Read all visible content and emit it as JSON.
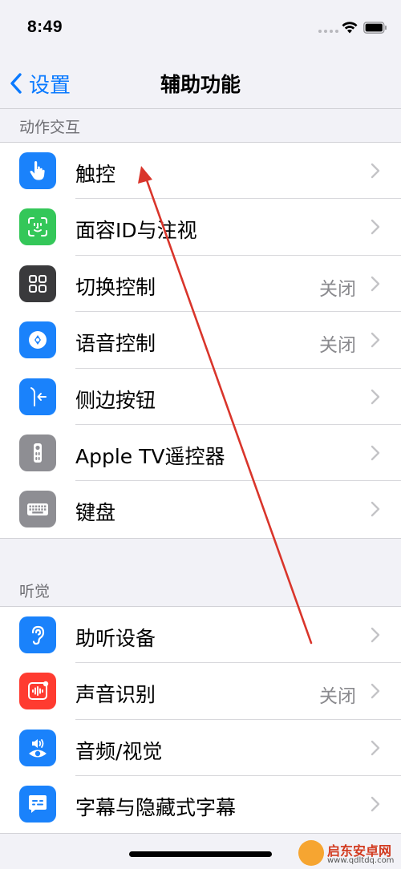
{
  "status_bar": {
    "time": "8:49"
  },
  "nav": {
    "back_label": "设置",
    "title": "辅助功能"
  },
  "sections": [
    {
      "header": "动作交互",
      "rows": [
        {
          "name": "touch",
          "label": "触控",
          "value": "",
          "icon": "hand-pointer-icon",
          "color": "#1a82fb"
        },
        {
          "name": "face-id",
          "label": "面容ID与注视",
          "value": "",
          "icon": "face-id-icon",
          "color": "#34c759"
        },
        {
          "name": "switch-control",
          "label": "切换控制",
          "value": "关闭",
          "icon": "grid-squares-icon",
          "color": "#3a3a3c"
        },
        {
          "name": "voice-control",
          "label": "语音控制",
          "value": "关闭",
          "icon": "voice-control-icon",
          "color": "#1a82fb"
        },
        {
          "name": "side-button",
          "label": "侧边按钮",
          "value": "",
          "icon": "side-button-icon",
          "color": "#1a82fb"
        },
        {
          "name": "apple-tv-remote",
          "label": "Apple TV遥控器",
          "value": "",
          "icon": "tv-remote-icon",
          "color": "#8e8e93"
        },
        {
          "name": "keyboard",
          "label": "键盘",
          "value": "",
          "icon": "keyboard-icon",
          "color": "#8e8e93"
        }
      ]
    },
    {
      "header": "听觉",
      "rows": [
        {
          "name": "hearing-devices",
          "label": "助听设备",
          "value": "",
          "icon": "ear-icon",
          "color": "#1a82fb"
        },
        {
          "name": "sound-recognition",
          "label": "声音识别",
          "value": "关闭",
          "icon": "sound-recognition-icon",
          "color": "#ff3b30"
        },
        {
          "name": "audio-visual",
          "label": "音频/视觉",
          "value": "",
          "icon": "speaker-eye-icon",
          "color": "#1a82fb"
        },
        {
          "name": "subtitles-captions",
          "label": "字幕与隐藏式字幕",
          "value": "",
          "icon": "caption-bubble-icon",
          "color": "#1a82fb"
        }
      ]
    }
  ],
  "colors": {
    "ios_blue": "#0a7aff",
    "annotation_red": "#d9352b",
    "background": "#f2f2f7"
  },
  "watermark": {
    "title": "启东安卓网",
    "url": "www.qdltdq.com"
  }
}
